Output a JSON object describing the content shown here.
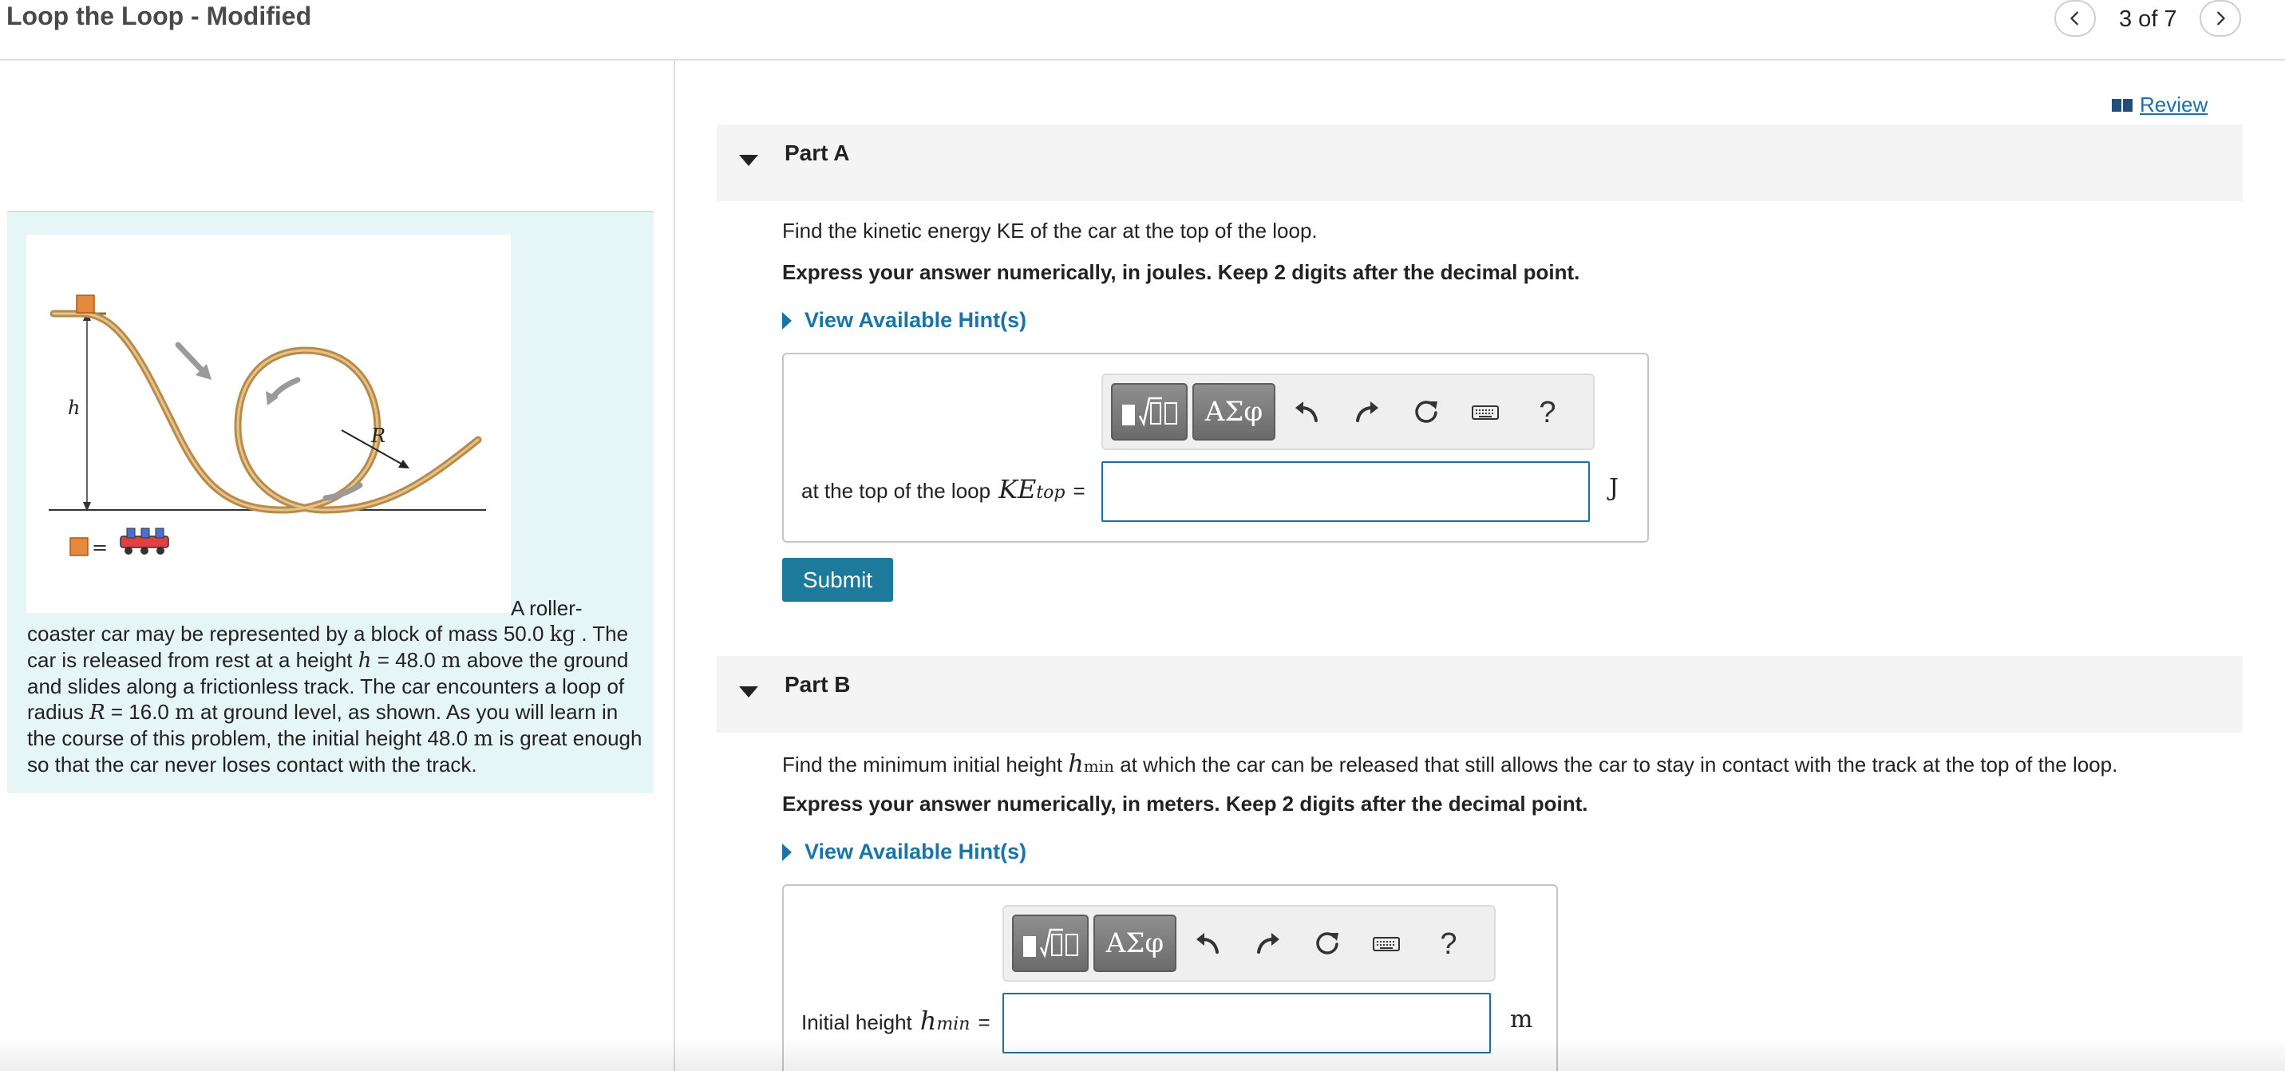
{
  "header": {
    "title": "Loop the Loop - Modified",
    "page_count": "3 of 7"
  },
  "review": {
    "label": "Review"
  },
  "intro": {
    "figure_labels": {
      "h": "h",
      "R": "R",
      "equals": "="
    },
    "text": {
      "first_line": "A roller-",
      "s1": "coaster car may be represented by a block of mass 50.0",
      "u_kg": "kg",
      "s2": ". The car is released from rest at a height",
      "v_h": "h",
      "s3": "= 48.0",
      "u_m1": "m",
      "s4": "above the ground and slides along a frictionless track. The car encounters a loop of radius",
      "v_R": "R",
      "s5": "= 16.0",
      "u_m2": "m",
      "s6": "at ground level, as shown. As you will learn in the course of this problem, the initial height 48.0",
      "u_m3": "m",
      "s7": "is great enough so that the car never loses contact with the track."
    }
  },
  "part_a": {
    "title": "Part A",
    "question": "Find the kinetic energy KE of the car at the top of the loop.",
    "instruction": "Express your answer numerically, in joules. Keep 2 digits after the decimal point.",
    "hint": "View Available Hint(s)",
    "toolbar": {
      "symbols": "ΑΣφ",
      "help": "?"
    },
    "answer_label": "at the top of the loop",
    "math_var": "KE",
    "math_sub": "top",
    "equals": "=",
    "input_value": "",
    "unit": "J",
    "submit": "Submit"
  },
  "part_b": {
    "title": "Part B",
    "question_pre": "Find the minimum initial height",
    "q_var": "h",
    "q_sub": "min",
    "question_post": "at which the car can be released that still allows the car to stay in contact with the track at the top of the loop.",
    "instruction": "Express your answer numerically, in meters. Keep 2 digits after the decimal point.",
    "hint": "View Available Hint(s)",
    "toolbar": {
      "symbols": "ΑΣφ",
      "help": "?"
    },
    "answer_label": "Initial height",
    "math_var": "h",
    "math_sub": "min",
    "equals": "=",
    "input_value": "",
    "unit": "m"
  },
  "icons": {
    "prev": "chevron-left-icon",
    "next": "chevron-right-icon",
    "review": "book-icon",
    "undo": "undo-icon",
    "redo": "redo-icon",
    "reset": "reset-icon",
    "keyboard": "keyboard-icon"
  },
  "colors": {
    "accent": "#1a74a8",
    "submit": "#1d7a9b",
    "intro_bg": "#e6f5f6",
    "track": "#b98a4a",
    "block": "#e58a3c"
  }
}
